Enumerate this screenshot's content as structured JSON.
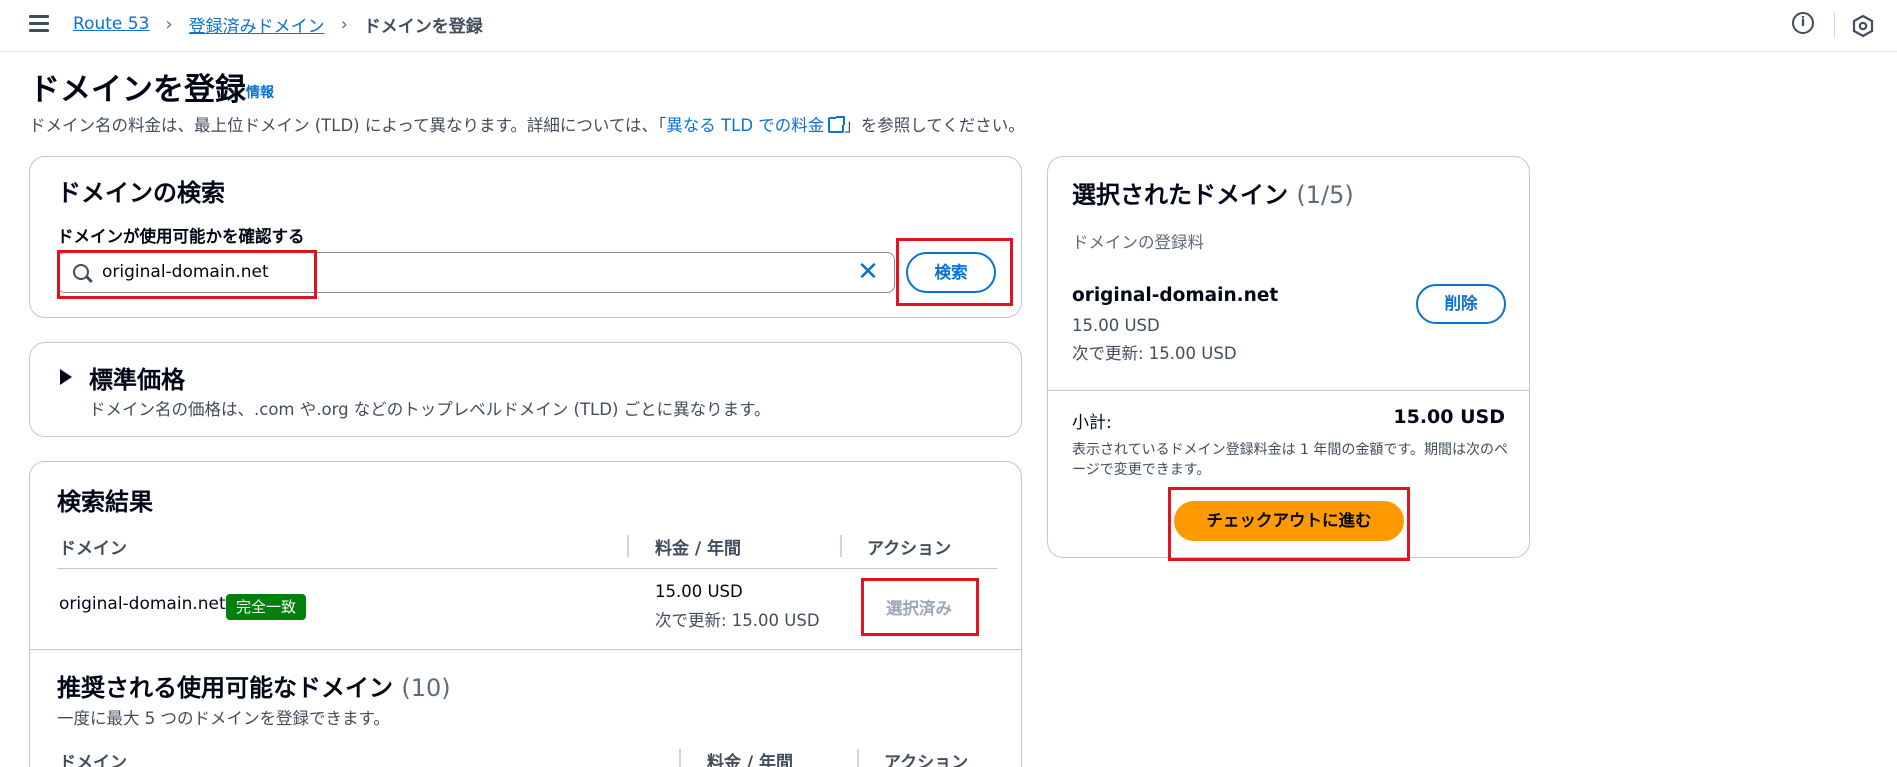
{
  "header": {
    "breadcrumbs": [
      "Route 53",
      "登録済みドメイン",
      "ドメインを登録"
    ],
    "separator": "›"
  },
  "page": {
    "title": "ドメインを登録",
    "info_link": "情報",
    "description_prefix": "ドメイン名の料金は、最上位ドメイン (TLD) によって異なります。詳細については、「",
    "description_link": "異なる TLD での料金",
    "description_suffix": "」を参照してください。"
  },
  "search": {
    "heading": "ドメインの検索",
    "field_label": "ドメインが使用可能かを確認する",
    "input_value": "original-domain.net",
    "clear_symbol": "✕",
    "button_label": "検索"
  },
  "standard_pricing": {
    "title": "標準価格",
    "description": "ドメイン名の価格は、.com や.org などのトップレベルドメイン (TLD) ごとに異なります。"
  },
  "results": {
    "heading": "検索結果",
    "columns": [
      "ドメイン",
      "料金 / 年間",
      "アクション"
    ],
    "row": {
      "domain": "original-domain.net",
      "badge": "完全一致",
      "price": "15.00 USD",
      "renewal": "次で更新: 15.00 USD",
      "action": "選択済み"
    }
  },
  "suggested": {
    "heading": "推奨される使用可能なドメイン",
    "count": "(10)",
    "description": "一度に最大 5 つのドメインを登録できます。",
    "columns": [
      "ドメイン",
      "料金 / 年間",
      "アクション"
    ]
  },
  "selected": {
    "heading": "選択されたドメイン",
    "count": "(1/5)",
    "subheading": "ドメインの登録料",
    "domain": "original-domain.net",
    "price": "15.00 USD",
    "renewal": "次で更新: 15.00 USD",
    "remove_label": "削除",
    "subtotal_label": "小計:",
    "subtotal_value": "15.00 USD",
    "note": "表示されているドメイン登録料金は 1 年間の金額です。期間は次のページで変更できます。",
    "checkout_label": "チェックアウトに進む"
  },
  "colors": {
    "link": "#0972d3",
    "highlight": "#e0141e",
    "badge": "#037f0c",
    "primary_button": "#ff9900"
  }
}
